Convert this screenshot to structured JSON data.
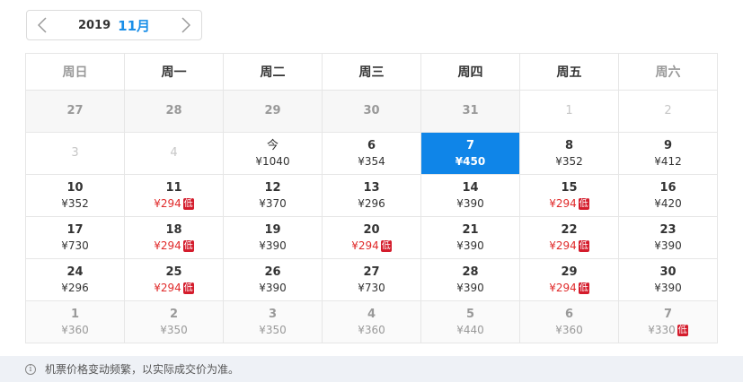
{
  "nav": {
    "year": "2019",
    "month": "11月"
  },
  "weekdays": [
    "周日",
    "周一",
    "周二",
    "周三",
    "周四",
    "周五",
    "周六"
  ],
  "weeks": [
    [
      {
        "day": "27",
        "price": "",
        "state": "grey"
      },
      {
        "day": "28",
        "price": "",
        "state": "grey"
      },
      {
        "day": "29",
        "price": "",
        "state": "grey"
      },
      {
        "day": "30",
        "price": "",
        "state": "grey"
      },
      {
        "day": "31",
        "price": "",
        "state": "grey"
      },
      {
        "day": "1",
        "price": "",
        "state": "faint"
      },
      {
        "day": "2",
        "price": "",
        "state": "faint"
      }
    ],
    [
      {
        "day": "3",
        "price": "",
        "state": "faint"
      },
      {
        "day": "4",
        "price": "",
        "state": "faint"
      },
      {
        "day": "今",
        "price": "¥1040",
        "state": "today"
      },
      {
        "day": "6",
        "price": "¥354",
        "state": "normal"
      },
      {
        "day": "7",
        "price": "¥450",
        "state": "selected"
      },
      {
        "day": "8",
        "price": "¥352",
        "state": "normal"
      },
      {
        "day": "9",
        "price": "¥412",
        "state": "normal"
      }
    ],
    [
      {
        "day": "10",
        "price": "¥352",
        "state": "normal"
      },
      {
        "day": "11",
        "price": "¥294",
        "state": "normal",
        "low": true
      },
      {
        "day": "12",
        "price": "¥370",
        "state": "normal"
      },
      {
        "day": "13",
        "price": "¥296",
        "state": "normal"
      },
      {
        "day": "14",
        "price": "¥390",
        "state": "normal"
      },
      {
        "day": "15",
        "price": "¥294",
        "state": "normal",
        "low": true
      },
      {
        "day": "16",
        "price": "¥420",
        "state": "normal"
      }
    ],
    [
      {
        "day": "17",
        "price": "¥730",
        "state": "normal"
      },
      {
        "day": "18",
        "price": "¥294",
        "state": "normal",
        "low": true
      },
      {
        "day": "19",
        "price": "¥390",
        "state": "normal"
      },
      {
        "day": "20",
        "price": "¥294",
        "state": "normal",
        "low": true
      },
      {
        "day": "21",
        "price": "¥390",
        "state": "normal"
      },
      {
        "day": "22",
        "price": "¥294",
        "state": "normal",
        "low": true
      },
      {
        "day": "23",
        "price": "¥390",
        "state": "normal"
      }
    ],
    [
      {
        "day": "24",
        "price": "¥296",
        "state": "normal"
      },
      {
        "day": "25",
        "price": "¥294",
        "state": "normal",
        "low": true
      },
      {
        "day": "26",
        "price": "¥390",
        "state": "normal"
      },
      {
        "day": "27",
        "price": "¥730",
        "state": "normal"
      },
      {
        "day": "28",
        "price": "¥390",
        "state": "normal"
      },
      {
        "day": "29",
        "price": "¥294",
        "state": "normal",
        "low": true
      },
      {
        "day": "30",
        "price": "¥390",
        "state": "normal"
      }
    ],
    [
      {
        "day": "1",
        "price": "¥360",
        "state": "next"
      },
      {
        "day": "2",
        "price": "¥350",
        "state": "next"
      },
      {
        "day": "3",
        "price": "¥350",
        "state": "next"
      },
      {
        "day": "4",
        "price": "¥360",
        "state": "next"
      },
      {
        "day": "5",
        "price": "¥440",
        "state": "next"
      },
      {
        "day": "6",
        "price": "¥360",
        "state": "next"
      },
      {
        "day": "7",
        "price": "¥330",
        "state": "next",
        "low": true
      }
    ]
  ],
  "low_label": "低",
  "notice": {
    "icon": "info-icon",
    "text": "机票价格变动频繁，以实际成交价为准。"
  },
  "colors": {
    "accent": "#1a8fe8",
    "selected_bg": "#0f85e8",
    "low_price": "#e02a2a",
    "low_badge": "#d41c2c"
  }
}
